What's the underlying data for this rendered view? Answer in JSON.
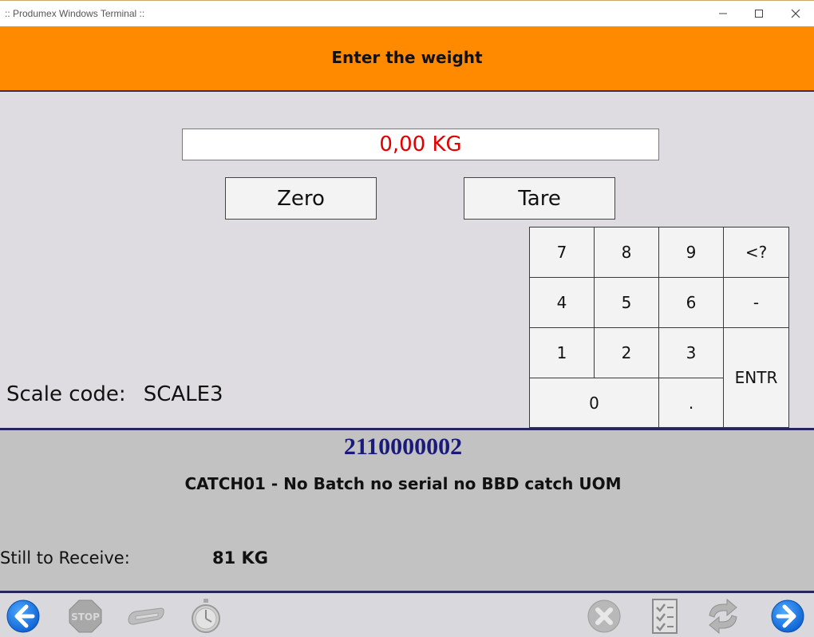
{
  "window": {
    "title": ":: Produmex Windows Terminal ::"
  },
  "header": {
    "title": "Enter the weight"
  },
  "weight": {
    "value": "0,00 KG"
  },
  "buttons": {
    "zero": "Zero",
    "tare": "Tare"
  },
  "scale": {
    "label": "Scale code:",
    "value": "SCALE3"
  },
  "keypad": {
    "k7": "7",
    "k8": "8",
    "k9": "9",
    "kback": "<?",
    "k4": "4",
    "k5": "5",
    "k6": "6",
    "kminus": "-",
    "k1": "1",
    "k2": "2",
    "k3": "3",
    "kenter": "ENTR",
    "k0": "0",
    "kdot": "."
  },
  "item": {
    "code": "2110000002",
    "description": "CATCH01 - No Batch no serial no BBD catch UOM",
    "still_label": "Still to Receive:",
    "still_value": "81 KG"
  },
  "toolbar": {
    "back_icon": "arrow-left-icon",
    "stop_icon": "stop-icon",
    "stop_text": "STOP",
    "scanner_icon": "scanner-icon",
    "timer_icon": "stopwatch-icon",
    "cancel_icon": "cancel-icon",
    "checklist_icon": "checklist-icon",
    "refresh_icon": "refresh-icon",
    "next_icon": "arrow-right-icon"
  },
  "colors": {
    "header": "#ff8a00",
    "weight_text": "#e00000",
    "item_code": "#1a1a7a",
    "nav_blue": "#1a78e6"
  }
}
